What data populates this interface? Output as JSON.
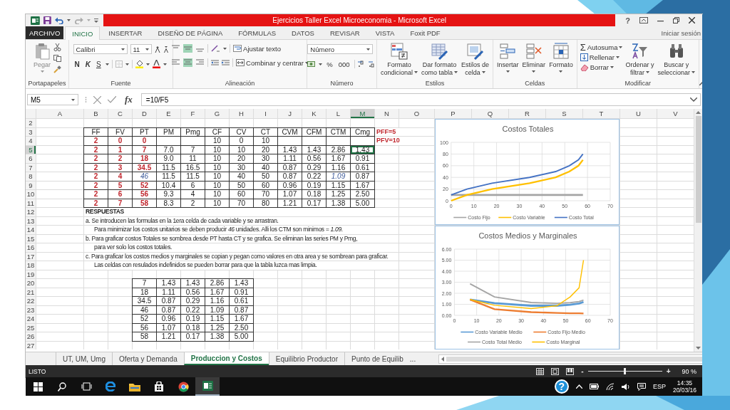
{
  "window": {
    "title": "Ejercicios Taller Excel Microeconomia -  Microsoft Excel",
    "help": "?"
  },
  "ribbon_tabs": [
    {
      "label": "ARCHIVO",
      "kind": "file",
      "selected": false
    },
    {
      "label": "INICIO",
      "kind": "tab",
      "selected": true
    },
    {
      "label": "INSERTAR",
      "kind": "tab",
      "selected": false
    },
    {
      "label": "DISEÑO DE PÁGINA",
      "kind": "tab",
      "selected": false
    },
    {
      "label": "FÓRMULAS",
      "kind": "tab",
      "selected": false
    },
    {
      "label": "DATOS",
      "kind": "tab",
      "selected": false
    },
    {
      "label": "REVISAR",
      "kind": "tab",
      "selected": false
    },
    {
      "label": "VISTA",
      "kind": "tab",
      "selected": false
    },
    {
      "label": "Foxit PDF",
      "kind": "tab",
      "selected": false
    }
  ],
  "account": "Iniciar sesión",
  "ribbon_groups": [
    {
      "kind": "clipboard",
      "label": "Portapapeles",
      "paste": "Pegar"
    },
    {
      "kind": "font",
      "label": "Fuente",
      "font": "Calibri",
      "size": "11",
      "styles": [
        "N",
        "K",
        "S"
      ]
    },
    {
      "kind": "alignment",
      "label": "Alineación",
      "wrap": "Ajustar texto",
      "merge": "Combinar y centrar",
      "vertical": [
        {
          "selected": false
        },
        {
          "selected": true
        },
        {
          "selected": false
        }
      ],
      "horizontal": [
        {
          "selected": false
        },
        {
          "selected": true
        },
        {
          "selected": false
        }
      ]
    },
    {
      "kind": "number",
      "label": "Número",
      "format": "Número",
      "symbols": [
        "%",
        "000"
      ]
    },
    {
      "kind": "large",
      "label": "Estilos",
      "buttons": [
        {
          "lines": [
            "Formato",
            "condicional"
          ]
        },
        {
          "lines": [
            "Dar formato",
            "como tabla"
          ]
        },
        {
          "lines": [
            "Estilos de",
            "celda"
          ]
        }
      ]
    },
    {
      "kind": "large",
      "label": "Celdas",
      "buttons": [
        {
          "lines": [
            "Insertar"
          ]
        },
        {
          "lines": [
            "Eliminar"
          ]
        },
        {
          "lines": [
            "Formato"
          ]
        }
      ]
    },
    {
      "kind": "editing",
      "label": "Modificar",
      "symbol": "Σ",
      "small": [
        "Autosuma",
        "Rellenar",
        "Borrar"
      ],
      "buttons": [
        {
          "lines": [
            "Ordenar y",
            "filtrar"
          ]
        },
        {
          "lines": [
            "Buscar y",
            "seleccionar"
          ]
        }
      ]
    }
  ],
  "formula_bar": {
    "name_box": "M5",
    "fx": "fx",
    "formula": "=10/F5"
  },
  "sheet": {
    "column_headers": [
      {
        "label": "A",
        "selected": false
      },
      {
        "label": "B",
        "selected": false
      },
      {
        "label": "C",
        "selected": false
      },
      {
        "label": "D",
        "selected": false
      },
      {
        "label": "E",
        "selected": false
      },
      {
        "label": "F",
        "selected": false
      },
      {
        "label": "G",
        "selected": false
      },
      {
        "label": "H",
        "selected": false
      },
      {
        "label": "I",
        "selected": false
      },
      {
        "label": "J",
        "selected": false
      },
      {
        "label": "K",
        "selected": false
      },
      {
        "label": "L",
        "selected": false
      },
      {
        "label": "M",
        "selected": true
      },
      {
        "label": "N",
        "selected": false
      },
      {
        "label": "O",
        "selected": false
      },
      {
        "label": "P",
        "selected": false
      },
      {
        "label": "Q",
        "selected": false
      },
      {
        "label": "R",
        "selected": false
      },
      {
        "label": "S",
        "selected": false
      },
      {
        "label": "T",
        "selected": false
      },
      {
        "label": "U",
        "selected": false
      },
      {
        "label": "V",
        "selected": false
      }
    ],
    "row_headers": [
      {
        "label": "2",
        "selected": false
      },
      {
        "label": "3",
        "selected": false
      },
      {
        "label": "4",
        "selected": false
      },
      {
        "label": "5",
        "selected": true
      },
      {
        "label": "6",
        "selected": false
      },
      {
        "label": "7",
        "selected": false
      },
      {
        "label": "8",
        "selected": false
      },
      {
        "label": "9",
        "selected": false
      },
      {
        "label": "10",
        "selected": false
      },
      {
        "label": "11",
        "selected": false
      },
      {
        "label": "12",
        "selected": false
      },
      {
        "label": "13",
        "selected": false
      },
      {
        "label": "14",
        "selected": false
      },
      {
        "label": "15",
        "selected": false
      },
      {
        "label": "16",
        "selected": false
      },
      {
        "label": "17",
        "selected": false
      },
      {
        "label": "18",
        "selected": false
      },
      {
        "label": "19",
        "selected": false
      },
      {
        "label": "20",
        "selected": false
      },
      {
        "label": "21",
        "selected": false
      },
      {
        "label": "22",
        "selected": false
      },
      {
        "label": "23",
        "selected": false
      },
      {
        "label": "24",
        "selected": false
      },
      {
        "label": "25",
        "selected": false
      },
      {
        "label": "26",
        "selected": false
      },
      {
        "label": "27",
        "selected": false
      }
    ],
    "table": {
      "columns": [
        "FF",
        "FV",
        "PT",
        "PM",
        "Pmg",
        "CF",
        "CV",
        "CT",
        "CVM",
        "CFM",
        "CTM",
        "Cmg"
      ],
      "rows": [
        {
          "cells": [
            {
              "text": "2",
              "kind": "input",
              "selected": false
            },
            {
              "text": "0",
              "kind": "input",
              "selected": false
            },
            {
              "text": "0",
              "kind": "input",
              "selected": false
            },
            {
              "selected": false
            },
            {
              "selected": false
            },
            {
              "text": "10",
              "kind": "value",
              "selected": false
            },
            {
              "text": "0",
              "kind": "value",
              "selected": false
            },
            {
              "text": "10",
              "kind": "value",
              "selected": false
            },
            {
              "selected": false
            },
            {
              "selected": false
            },
            {
              "selected": false
            },
            {
              "selected": false
            }
          ]
        },
        {
          "cells": [
            {
              "text": "2",
              "kind": "input",
              "selected": false
            },
            {
              "text": "1",
              "kind": "input",
              "selected": false
            },
            {
              "text": "7",
              "kind": "input",
              "selected": false
            },
            {
              "text": "7.0",
              "kind": "value",
              "selected": false
            },
            {
              "text": "7",
              "kind": "value",
              "selected": false
            },
            {
              "text": "10",
              "kind": "value",
              "selected": false
            },
            {
              "text": "10",
              "kind": "value",
              "selected": false
            },
            {
              "text": "20",
              "kind": "value",
              "selected": false
            },
            {
              "text": "1.43",
              "kind": "value",
              "selected": false
            },
            {
              "text": "1.43",
              "kind": "value",
              "selected": false
            },
            {
              "text": "2.86",
              "kind": "value",
              "selected": false
            },
            {
              "text": "1.43",
              "kind": "value",
              "selected": true
            }
          ]
        },
        {
          "cells": [
            {
              "text": "2",
              "kind": "input",
              "selected": false
            },
            {
              "text": "2",
              "kind": "input",
              "selected": false
            },
            {
              "text": "18",
              "kind": "input",
              "selected": false
            },
            {
              "text": "9.0",
              "kind": "value",
              "selected": false
            },
            {
              "text": "11",
              "kind": "value",
              "selected": false
            },
            {
              "text": "10",
              "kind": "value",
              "selected": false
            },
            {
              "text": "20",
              "kind": "value",
              "selected": false
            },
            {
              "text": "30",
              "kind": "value",
              "selected": false
            },
            {
              "text": "1.11",
              "kind": "value",
              "selected": false
            },
            {
              "text": "0.56",
              "kind": "value",
              "selected": false
            },
            {
              "text": "1.67",
              "kind": "value",
              "selected": false
            },
            {
              "text": "0.91",
              "kind": "value",
              "selected": false
            }
          ]
        },
        {
          "cells": [
            {
              "text": "2",
              "kind": "input",
              "selected": false
            },
            {
              "text": "3",
              "kind": "input",
              "selected": false
            },
            {
              "text": "34.5",
              "kind": "input",
              "selected": false
            },
            {
              "text": "11.5",
              "kind": "value",
              "selected": false
            },
            {
              "text": "16.5",
              "kind": "value",
              "selected": false
            },
            {
              "text": "10",
              "kind": "value",
              "selected": false
            },
            {
              "text": "30",
              "kind": "value",
              "selected": false
            },
            {
              "text": "40",
              "kind": "value",
              "selected": false
            },
            {
              "text": "0.87",
              "kind": "value",
              "selected": false
            },
            {
              "text": "0.29",
              "kind": "value",
              "selected": false
            },
            {
              "text": "1.16",
              "kind": "value",
              "selected": false
            },
            {
              "text": "0.61",
              "kind": "value",
              "selected": false
            }
          ]
        },
        {
          "cells": [
            {
              "text": "2",
              "kind": "input",
              "selected": false
            },
            {
              "text": "4",
              "kind": "input",
              "selected": false
            },
            {
              "text": "46",
              "kind": "highlight",
              "selected": false
            },
            {
              "text": "11.5",
              "kind": "value",
              "selected": false
            },
            {
              "text": "11.5",
              "kind": "value",
              "selected": false
            },
            {
              "text": "10",
              "kind": "value",
              "selected": false
            },
            {
              "text": "40",
              "kind": "value",
              "selected": false
            },
            {
              "text": "50",
              "kind": "value",
              "selected": false
            },
            {
              "text": "0.87",
              "kind": "value",
              "selected": false
            },
            {
              "text": "0.22",
              "kind": "value",
              "selected": false
            },
            {
              "text": "1.09",
              "kind": "highlight",
              "selected": false
            },
            {
              "text": "0.87",
              "kind": "value",
              "selected": false
            }
          ]
        },
        {
          "cells": [
            {
              "text": "2",
              "kind": "input",
              "selected": false
            },
            {
              "text": "5",
              "kind": "input",
              "selected": false
            },
            {
              "text": "52",
              "kind": "input",
              "selected": false
            },
            {
              "text": "10.4",
              "kind": "value",
              "selected": false
            },
            {
              "text": "6",
              "kind": "value",
              "selected": false
            },
            {
              "text": "10",
              "kind": "value",
              "selected": false
            },
            {
              "text": "50",
              "kind": "value",
              "selected": false
            },
            {
              "text": "60",
              "kind": "value",
              "selected": false
            },
            {
              "text": "0.96",
              "kind": "value",
              "selected": false
            },
            {
              "text": "0.19",
              "kind": "value",
              "selected": false
            },
            {
              "text": "1.15",
              "kind": "value",
              "selected": false
            },
            {
              "text": "1.67",
              "kind": "value",
              "selected": false
            }
          ]
        },
        {
          "cells": [
            {
              "text": "2",
              "kind": "input",
              "selected": false
            },
            {
              "text": "6",
              "kind": "input",
              "selected": false
            },
            {
              "text": "56",
              "kind": "input",
              "selected": false
            },
            {
              "text": "9.3",
              "kind": "value",
              "selected": false
            },
            {
              "text": "4",
              "kind": "value",
              "selected": false
            },
            {
              "text": "10",
              "kind": "value",
              "selected": false
            },
            {
              "text": "60",
              "kind": "value",
              "selected": false
            },
            {
              "text": "70",
              "kind": "value",
              "selected": false
            },
            {
              "text": "1.07",
              "kind": "value",
              "selected": false
            },
            {
              "text": "0.18",
              "kind": "value",
              "selected": false
            },
            {
              "text": "1.25",
              "kind": "value",
              "selected": false
            },
            {
              "text": "2.50",
              "kind": "value",
              "selected": false
            }
          ]
        },
        {
          "cells": [
            {
              "text": "2",
              "kind": "input",
              "selected": false
            },
            {
              "text": "7",
              "kind": "input",
              "selected": false
            },
            {
              "text": "58",
              "kind": "input",
              "selected": false
            },
            {
              "text": "8.3",
              "kind": "value",
              "selected": false
            },
            {
              "text": "2",
              "kind": "value",
              "selected": false
            },
            {
              "text": "10",
              "kind": "value",
              "selected": false
            },
            {
              "text": "70",
              "kind": "value",
              "selected": false
            },
            {
              "text": "80",
              "kind": "value",
              "selected": false
            },
            {
              "text": "1.21",
              "kind": "value",
              "selected": false
            },
            {
              "text": "0.17",
              "kind": "value",
              "selected": false
            },
            {
              "text": "1.38",
              "kind": "value",
              "selected": false
            },
            {
              "text": "5.00",
              "kind": "value",
              "selected": false
            }
          ]
        }
      ]
    },
    "notes": [
      "PFF=5",
      "PFV=10"
    ],
    "answers": [
      {
        "text": "RESPUESTAS",
        "kind": "heading"
      },
      {
        "text": "a. Se introducen las formulas en la 1era celda de cada variable y se arrastran.",
        "kind": "item"
      },
      {
        "text": "Para minimizar los costos unitarios se deben producir *46*  unidades. Alli los CTM son minimos *= 1.09.*",
        "kind": "continuation"
      },
      {
        "text": "b. Para graficar costos Totales se sombrea desde PT hasta CT y se grafica. Se eliminan las series PM y Pmg,",
        "kind": "item"
      },
      {
        "text": "para ver solo los costos totales.",
        "kind": "continuation"
      },
      {
        "text": "c. Para graficar los costos medios y marginales se copian y pegan como valores en otra area y se sombrean para graficar.",
        "kind": "item"
      },
      {
        "text": "Las celdas con resulados indefinidos se pueden borrar para que la tabla luzca mas limpia.",
        "kind": "continuation"
      }
    ],
    "copy_table": {
      "rows": [
        [
          "7",
          "1.43",
          "1.43",
          "2.86",
          "1.43"
        ],
        [
          "18",
          "1.11",
          "0.56",
          "1.67",
          "0.91"
        ],
        [
          "34.5",
          "0.87",
          "0.29",
          "1.16",
          "0.61"
        ],
        [
          "46",
          "0.87",
          "0.22",
          "1.09",
          "0.87"
        ],
        [
          "52",
          "0.96",
          "0.19",
          "1.15",
          "1.67"
        ],
        [
          "56",
          "1.07",
          "0.18",
          "1.25",
          "2.50"
        ],
        [
          "58",
          "1.21",
          "0.17",
          "1.38",
          "5.00"
        ]
      ]
    }
  },
  "charts": [
    {
      "chart_data": {
        "type": "line",
        "title": "Costos Totales",
        "grid": true,
        "legend": "bottom",
        "x": [
          0,
          7,
          18,
          34.5,
          46,
          52,
          56,
          58
        ],
        "xlim": [
          0,
          70
        ],
        "ylim": [
          0,
          100
        ],
        "xticks": [
          0,
          10,
          20,
          30,
          40,
          50,
          60,
          70
        ],
        "yticks": [
          0,
          20,
          40,
          60,
          80,
          100
        ],
        "series": [
          {
            "name": "Costo Fijo",
            "color": "#a5a5a5",
            "values": [
              10,
              10,
              10,
              10,
              10,
              10,
              10,
              10
            ]
          },
          {
            "name": "Costo Variable",
            "color": "#ffc000",
            "values": [
              0,
              10,
              20,
              30,
              40,
              50,
              60,
              70
            ]
          },
          {
            "name": "Costo Total",
            "color": "#4472c4",
            "values": [
              10,
              20,
              30,
              40,
              50,
              60,
              70,
              80
            ]
          }
        ]
      }
    },
    {
      "chart_data": {
        "type": "line",
        "title": "Costos Medios y Marginales",
        "grid": true,
        "legend": "bottom",
        "x": [
          7,
          18,
          34.5,
          46,
          52,
          56,
          58
        ],
        "xlim": [
          0,
          70
        ],
        "ylim": [
          0,
          6
        ],
        "xticks": [
          0,
          10,
          20,
          30,
          40,
          50,
          60,
          70
        ],
        "yticks": [
          {
            "value": 0,
            "label": "0.00"
          },
          {
            "value": 1,
            "label": "1.00"
          },
          {
            "value": 2,
            "label": "2.00"
          },
          {
            "value": 3,
            "label": "3.00"
          },
          {
            "value": 4,
            "label": "4.00"
          },
          {
            "value": 5,
            "label": "5.00"
          },
          {
            "value": 6,
            "label": "6.00"
          }
        ],
        "series": [
          {
            "name": "Costo Variable Medio",
            "color": "#5b9bd5",
            "values": [
              1.43,
              1.11,
              0.87,
              0.87,
              0.96,
              1.07,
              1.21
            ]
          },
          {
            "name": "Costo Fijo Medio",
            "color": "#ed7d31",
            "values": [
              1.43,
              0.56,
              0.29,
              0.22,
              0.19,
              0.18,
              0.17
            ]
          },
          {
            "name": "Costo Total Medio",
            "color": "#a5a5a5",
            "values": [
              2.86,
              1.67,
              1.16,
              1.09,
              1.15,
              1.25,
              1.38
            ]
          },
          {
            "name": "Costo Marginal",
            "color": "#ffc000",
            "values": [
              1.43,
              0.91,
              0.61,
              0.87,
              1.67,
              2.5,
              5
            ]
          }
        ]
      }
    }
  ],
  "sheet_tabs": {
    "tabs": [
      {
        "label": "UT, UM, Umg",
        "selected": false
      },
      {
        "label": "Oferta y Demanda",
        "selected": false
      },
      {
        "label": "Produccion y Costos",
        "selected": true
      },
      {
        "label": "Equilibrio Productor",
        "selected": false
      },
      {
        "label": "Punto de Equilib",
        "selected": false
      }
    ],
    "more": "..."
  },
  "status_bar": {
    "status": "LISTO",
    "zoom_out": "-",
    "zoom_in": "+",
    "zoom": "90 %",
    "zoom_slider": {
      "level": 0.5
    }
  },
  "taskbar": {
    "help": "?",
    "language": "ESP",
    "time": "14:35",
    "date": "20/03/16"
  }
}
